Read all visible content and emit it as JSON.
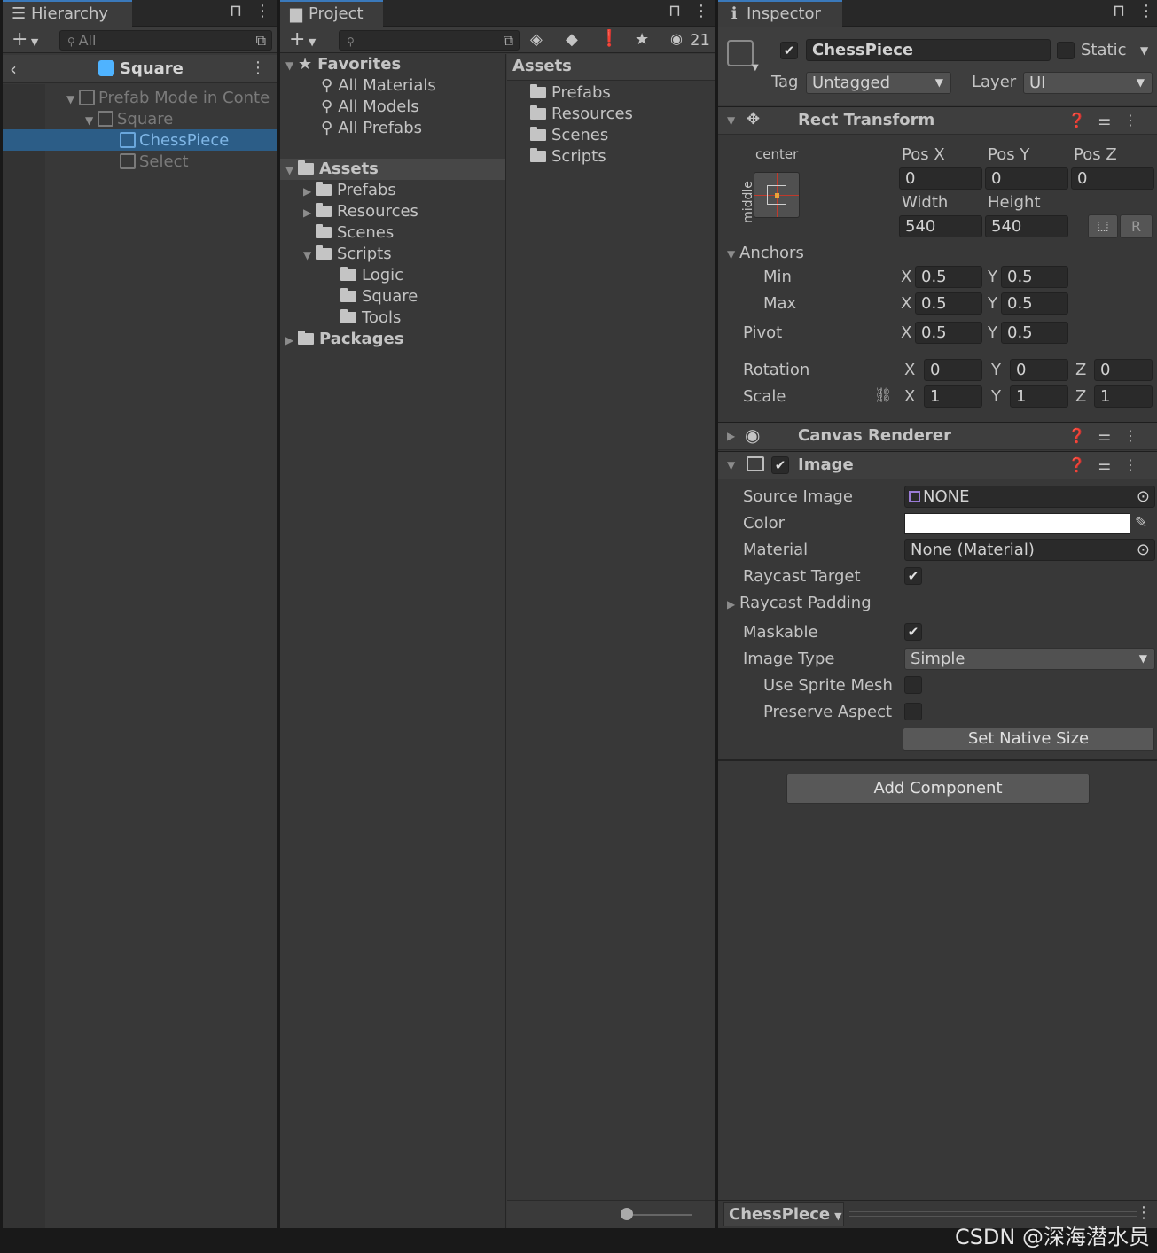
{
  "hierarchy": {
    "tab_label": "Hierarchy",
    "search_placeholder": "All",
    "scene_title": "Square",
    "items": [
      {
        "label": "Prefab Mode in Conte"
      },
      {
        "label": "Square"
      },
      {
        "label": "ChessPiece"
      },
      {
        "label": "Select"
      }
    ]
  },
  "project": {
    "tab_label": "Project",
    "hidden_count": "21",
    "favorites": {
      "label": "Favorites",
      "items": [
        "All Materials",
        "All Models",
        "All Prefabs"
      ]
    },
    "tree": {
      "assets_label": "Assets",
      "items": [
        "Prefabs",
        "Resources",
        "Scenes",
        "Scripts",
        "Logic",
        "Square",
        "Tools"
      ],
      "packages_label": "Packages"
    },
    "content": {
      "header": "Assets",
      "items": [
        "Prefabs",
        "Resources",
        "Scenes",
        "Scripts"
      ]
    }
  },
  "inspector": {
    "tab_label": "Inspector",
    "object_name": "ChessPiece",
    "static_label": "Static",
    "tag_label": "Tag",
    "tag_value": "Untagged",
    "layer_label": "Layer",
    "layer_value": "UI",
    "rect_transform": {
      "title": "Rect Transform",
      "anchor_h": "center",
      "anchor_v": "middle",
      "posx_label": "Pos X",
      "posx": "0",
      "posy_label": "Pos Y",
      "posy": "0",
      "posz_label": "Pos Z",
      "posz": "0",
      "width_label": "Width",
      "width": "540",
      "height_label": "Height",
      "height": "540",
      "raw_button": "R",
      "anchors_label": "Anchors",
      "min_label": "Min",
      "min_x": "0.5",
      "min_y": "0.5",
      "max_label": "Max",
      "max_x": "0.5",
      "max_y": "0.5",
      "pivot_label": "Pivot",
      "pivot_x": "0.5",
      "pivot_y": "0.5",
      "rotation_label": "Rotation",
      "rot_x": "0",
      "rot_y": "0",
      "rot_z": "0",
      "scale_label": "Scale",
      "scale_x": "1",
      "scale_y": "1",
      "scale_z": "1",
      "x": "X",
      "y": "Y",
      "z": "Z"
    },
    "canvas_renderer": {
      "title": "Canvas Renderer"
    },
    "image": {
      "title": "Image",
      "source_image_label": "Source Image",
      "source_image": "NONE",
      "color_label": "Color",
      "color": "#ffffff",
      "material_label": "Material",
      "material": "None (Material)",
      "raycast_target_label": "Raycast Target",
      "raycast_padding_label": "Raycast Padding",
      "maskable_label": "Maskable",
      "image_type_label": "Image Type",
      "image_type": "Simple",
      "use_sprite_mesh_label": "Use Sprite Mesh",
      "preserve_aspect_label": "Preserve Aspect",
      "set_native_size": "Set Native Size"
    },
    "add_component": "Add Component",
    "footer_object": "ChessPiece"
  },
  "watermark": "CSDN @深海潜水员",
  "colors": {
    "accent": "#3a79bb",
    "selection": "#2c5d87",
    "cube_blue": "#4fb3ff"
  }
}
